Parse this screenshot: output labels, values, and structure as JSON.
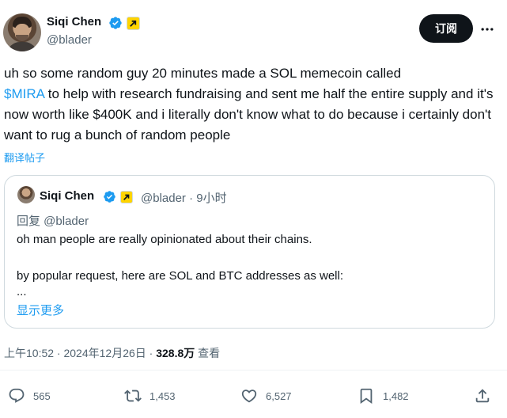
{
  "header": {
    "name": "Siqi Chen",
    "handle": "@blader",
    "subscribe_label": "订阅"
  },
  "post": {
    "line1": "uh so some random guy 20 minutes made a SOL memecoin called",
    "hashtag": "$MIRA",
    "line2": " to help with research fundraising and sent me half the entire supply and it's now worth like $400K and i literally don't know what to do because i certainly don't want to rug a bunch of random people",
    "translate": "翻译帖子"
  },
  "quote": {
    "name": "Siqi Chen",
    "meta": "@blader · 9小时",
    "reply_to": "回复 @blader",
    "lines": [
      "oh man people are really opinionated about their chains.",
      "by popular request, here are SOL and BTC addresses as well:",
      "..."
    ],
    "show_more": "显示更多"
  },
  "timeline": {
    "time_date": "上午10:52 · 2024年12月26日 · ",
    "views_count": "328.8万",
    "views_label": " 查看"
  },
  "actions": {
    "replies": "565",
    "reposts": "1,453",
    "likes": "6,527",
    "bookmarks": "1,482"
  },
  "colors": {
    "accent": "#1d9bf0",
    "text": "#0f1419",
    "muted": "#536471",
    "border": "#cfd9de"
  }
}
